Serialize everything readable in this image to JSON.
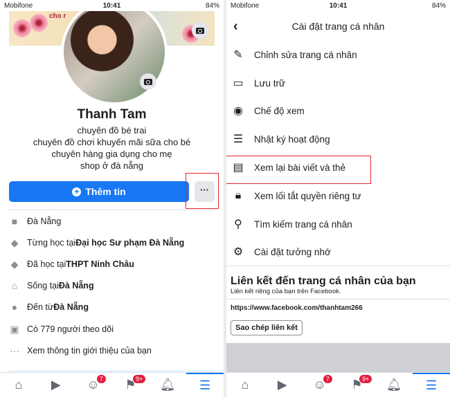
{
  "status": {
    "carrier": "Mobifone",
    "time": "10:41",
    "battery": "84%"
  },
  "profile": {
    "name": "Thanh Tam",
    "bio": [
      "chuyên đồ bé trai",
      "chuyên đồ chơi khuyến mãi sữa cho bé",
      "chuyên hàng gia dụng cho mẹ",
      "shop ở đà nẵng"
    ],
    "cover_text": "cho r",
    "add_info": "Thêm tin",
    "more": "···"
  },
  "info": [
    {
      "icon": "briefcase-icon",
      "pre": "Đà Nẵng",
      "bold": ""
    },
    {
      "icon": "graduation-cap-icon",
      "pre": "Từng học tại ",
      "bold": "Đại học Sư phạm Đà Nẵng"
    },
    {
      "icon": "graduation-cap-icon",
      "pre": "Đã học tại ",
      "bold": "THPT Ninh Châu"
    },
    {
      "icon": "home-icon",
      "pre": "Sống tại ",
      "bold": "Đà Nẵng"
    },
    {
      "icon": "location-pin-icon",
      "pre": "Đến từ ",
      "bold": "Đà Nẵng"
    },
    {
      "icon": "followers-icon",
      "pre": "Có 779 người theo dõi",
      "bold": ""
    },
    {
      "icon": "more-dots-icon",
      "pre": "Xem thông tin giới thiệu của bạn",
      "bold": ""
    }
  ],
  "nav": {
    "groups_badge": "7",
    "pages_badge": "9+"
  },
  "settings": {
    "title": "Cài đặt trang cá nhân",
    "items": [
      {
        "icon": "pencil-icon",
        "label": "Chỉnh sửa trang cá nhân"
      },
      {
        "icon": "archive-icon",
        "label": "Lưu trữ"
      },
      {
        "icon": "eye-icon",
        "label": "Chế độ xem"
      },
      {
        "icon": "list-icon",
        "label": "Nhật ký hoạt động"
      },
      {
        "icon": "review-posts-icon",
        "label": "Xem lại bài viết và thẻ"
      },
      {
        "icon": "lock-icon",
        "label": "Xem lối tắt quyền riêng tư"
      },
      {
        "icon": "search-icon",
        "label": "Tìm kiếm trang cá nhân"
      },
      {
        "icon": "memorial-settings-icon",
        "label": "Cài đặt tưởng nhớ"
      }
    ],
    "link_title": "Liên kết đến trang cá nhân của bạn",
    "link_subtitle": "Liên kết riêng của bạn trên Facebook.",
    "url": "https://www.facebook.com/thanhtam266",
    "copy_label": "Sao chép liên kết"
  },
  "colors": {
    "accent": "#1877f2",
    "highlight": "#e0262b",
    "badge": "#e41e3f"
  }
}
